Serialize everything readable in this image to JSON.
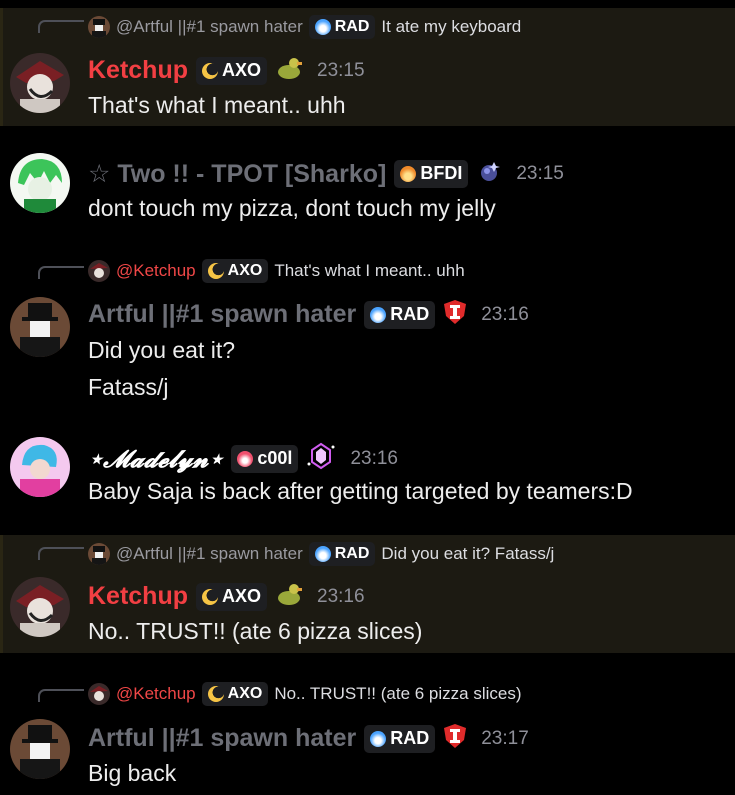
{
  "colors": {
    "background": "#000000",
    "highlight": "#1c1a12",
    "ketchup_red": "#f23f43",
    "mention_red": "#f04747",
    "muted_name": "#6d6f77",
    "timestamp": "#8f9099",
    "tag_bg": "#1e1f22"
  },
  "messages": [
    {
      "reply": {
        "name": "@Artful ||#1 spawn hater",
        "tag": "RAD",
        "text": "It ate my keyboard"
      },
      "author": "Ketchup",
      "tag": "AXO",
      "badge_icon": "duck-icon",
      "time": "23:15",
      "lines": [
        "That's what I meant.. uhh"
      ]
    },
    {
      "author": "☆ Two !! - TPOT [Sharko]",
      "tag": "BFDI",
      "badge_icon": "planet-icon",
      "time": "23:15",
      "lines": [
        "dont touch my pizza, dont touch my jelly"
      ]
    },
    {
      "reply": {
        "name": "@Ketchup",
        "tag": "AXO",
        "text": "That's what I meant.. uhh"
      },
      "author": "Artful ||#1 spawn hater",
      "tag": "RAD",
      "badge_icon": "shield-icon",
      "time": "23:16",
      "lines": [
        "Did you eat it?",
        "Fatass/j"
      ]
    },
    {
      "author": "⋆𝓜𝓪𝓭𝓮𝓵𝔂𝓷⋆",
      "tag": "c00l",
      "badge_icon": "crystal-icon",
      "time": "23:16",
      "lines": [
        "Baby Saja is back after getting targeted by teamers:D"
      ]
    },
    {
      "reply": {
        "name": "@Artful ||#1 spawn hater",
        "tag": "RAD",
        "text": "Did you eat it? Fatass/j"
      },
      "author": "Ketchup",
      "tag": "AXO",
      "badge_icon": "duck-icon",
      "time": "23:16",
      "lines": [
        "No.. TRUST!! (ate 6 pizza slices)"
      ]
    },
    {
      "reply": {
        "name": "@Ketchup",
        "tag": "AXO",
        "text": "No.. TRUST!! (ate 6 pizza slices)"
      },
      "author": "Artful ||#1 spawn hater",
      "tag": "RAD",
      "badge_icon": "shield-icon",
      "time": "23:17",
      "lines": [
        "Big back"
      ]
    }
  ]
}
